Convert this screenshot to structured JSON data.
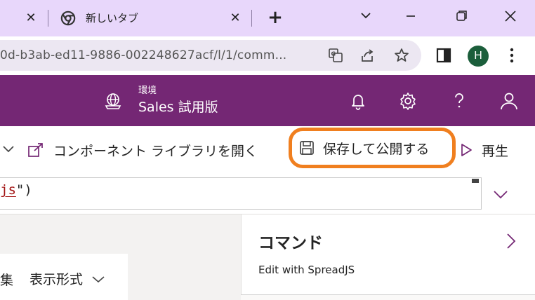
{
  "browser": {
    "tabs": [
      {
        "title": ""
      },
      {
        "title": "新しいタブ"
      }
    ],
    "url": "0d-b3ab-ed11-9886-002248627acf/l/1/comm...",
    "profile_initial": "H"
  },
  "app_header": {
    "env_label": "環境",
    "env_name": "Sales 試用版"
  },
  "command_bar": {
    "open_library_label": "コンポーネント ライブラリを開く",
    "save_publish_label": "保存して公開する",
    "play_label": "再生"
  },
  "formula": {
    "prefix": "",
    "string_part": "js",
    "suffix": "\")"
  },
  "properties": {
    "edge_label": "集",
    "format_label": "表示形式"
  },
  "panel": {
    "title": "コマンド",
    "subtitle": "Edit with SpreadJS"
  },
  "colors": {
    "tabstrip": "#e8d7fb",
    "header": "#742774",
    "highlight": "#f07f1f"
  }
}
